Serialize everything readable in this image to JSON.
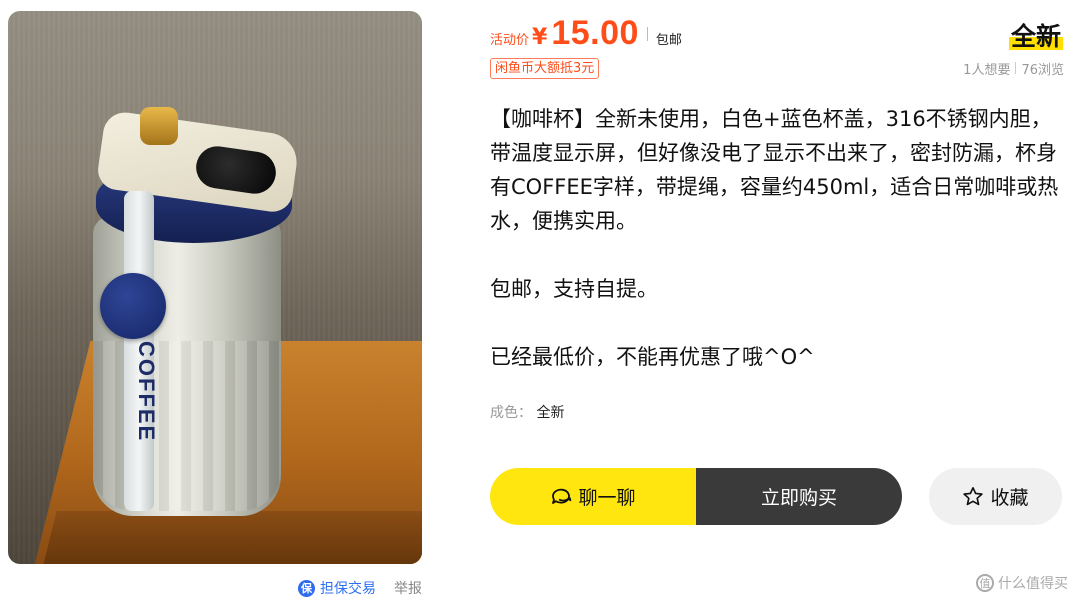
{
  "product_image": {
    "icon": "tumbler-photo",
    "strap_text": "COFFEE"
  },
  "below_image": {
    "guarantee_icon_char": "保",
    "guarantee_label": "担保交易",
    "report_label": "举报"
  },
  "price": {
    "label": "活动价",
    "currency": "¥",
    "value": "15.00",
    "shipping": "包邮"
  },
  "coin_badge": "闲鱼币大额抵3元",
  "condition_badge": "全新",
  "stats": {
    "wants": "1人想要",
    "views": "76浏览"
  },
  "description": [
    "【咖啡杯】全新未使用，白色+蓝色杯盖，316不锈钢内胆，带温度显示屏，但好像没电了显示不出来了，密封防漏，杯身有COFFEE字样，带提绳，容量约450ml，适合日常咖啡或热水，便携实用。",
    "包邮，支持自提。",
    "已经最低价，不能再优惠了哦^O^"
  ],
  "attributes": {
    "condition_key": "成色：",
    "condition_value": "全新"
  },
  "actions": {
    "chat_label": "聊一聊",
    "chat_icon": "chat-bubble-icon",
    "buy_label": "立即购买",
    "favorite_label": "收藏",
    "favorite_icon": "star-outline-icon"
  },
  "watermark": {
    "icon_char": "值",
    "text": "什么值得买"
  },
  "colors": {
    "price_accent": "#ff4d1a",
    "brand_yellow": "#ffe60f",
    "buy_button": "#3a3a3a",
    "guarantee_blue": "#2d6ff2"
  }
}
